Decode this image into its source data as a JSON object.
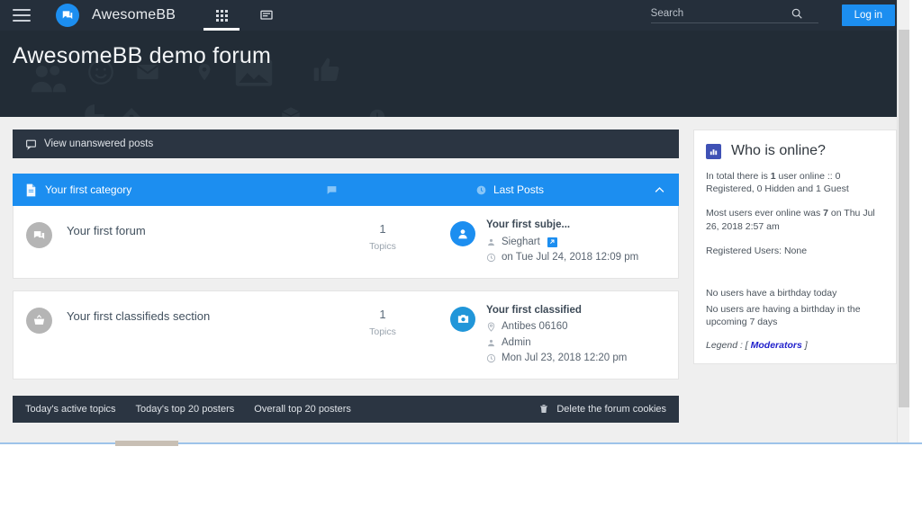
{
  "nav": {
    "menu_icon": "hamburger-icon",
    "logo_icon": "chat-bubble-icon",
    "brand": "AwesomeBB",
    "tabs": [
      {
        "icon": "apps-grid-icon",
        "active": true
      },
      {
        "icon": "message-icon",
        "active": false
      }
    ],
    "search": {
      "placeholder": "Search",
      "value": "",
      "icon": "search-icon"
    },
    "login_label": "Log in"
  },
  "hero": {
    "title": "AwesomeBB demo forum",
    "decor_icons": [
      "people-icon",
      "smiley-icon",
      "envelope-icon",
      "map-pin-icon",
      "image-icon",
      "thumbs-up-icon",
      "pie-chart-icon",
      "tag-icon",
      "box-icon",
      "clock-icon"
    ]
  },
  "toolbar": {
    "unanswered_label": "View unanswered posts",
    "unanswered_icon": "comment-icon"
  },
  "category": {
    "title": "Your first category",
    "title_icon": "file-icon",
    "topics_icon": "comment-icon",
    "last_posts_label": "Last Posts",
    "last_posts_icon": "clock-icon",
    "collapse_icon": "chevron-up-icon"
  },
  "forums": [
    {
      "icon": "chat-bubble-icon",
      "name": "Your first forum",
      "count": "1",
      "count_label": "Topics",
      "last_post": {
        "icon": "person-avatar-icon",
        "icon_color": "#1c8ef0",
        "title": "Your first subje...",
        "author": "Sieghart",
        "author_icon": "person-icon",
        "badge_icon": "goto-post-icon",
        "location": null,
        "location_icon": null,
        "time": "on Tue Jul 24, 2018 12:09 pm",
        "time_icon": "clock-icon"
      }
    },
    {
      "icon": "basket-icon",
      "name": "Your first classifieds section",
      "count": "1",
      "count_label": "Topics",
      "last_post": {
        "icon": "camera-icon",
        "icon_color": "#2196d9",
        "title": "Your first classified",
        "author": "Admin",
        "author_icon": "person-icon",
        "badge_icon": null,
        "location": "Antibes 06160",
        "location_icon": "map-pin-icon",
        "time": "Mon Jul 23, 2018 12:20 pm",
        "time_icon": "clock-icon"
      }
    }
  ],
  "footer": {
    "links": [
      "Today's active topics",
      "Today's top 20 posters",
      "Overall top 20 posters"
    ],
    "delete_cookies_label": "Delete the forum cookies",
    "delete_icon": "trash-icon"
  },
  "sidebar": {
    "title": "Who is online?",
    "title_icon": "chart-bar-icon",
    "online_line_1": "In total there is ",
    "online_count": "1",
    "online_line_2": " user online :: 0 Registered, 0 Hidden and 1 Guest",
    "record_line_1": "Most users ever online was ",
    "record_count": "7",
    "record_line_2": " on Thu Jul 26, 2018 2:57 am",
    "registered_users": "Registered Users: None",
    "birthday_line_1": "No users have a birthday today",
    "birthday_line_2": "No users are having a birthday in the upcoming 7 days",
    "legend_prefix": "Legend : [ ",
    "legend_link": "Moderators",
    "legend_suffix": " ]"
  },
  "colors": {
    "accent": "#1c8ef0",
    "nav_bg": "#252f3b",
    "hero_bg": "#222c36",
    "panel_dark": "#2b3542",
    "page_bg": "#efefef"
  }
}
